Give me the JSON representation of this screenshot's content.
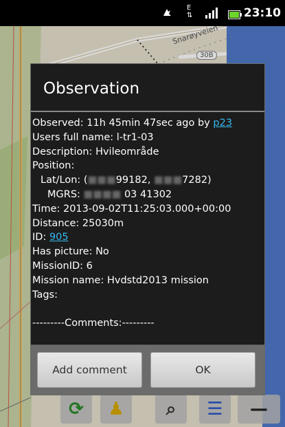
{
  "status_bar": {
    "time": "23:10",
    "icons": [
      "gps-icon",
      "data-arrows-icon",
      "signal-icon",
      "battery-icon"
    ],
    "network_letter": "E"
  },
  "map": {
    "road_labels": [
      "Snarøyveien",
      "30B"
    ]
  },
  "dialog": {
    "title": "Observation",
    "observed_prefix": "Observed:  11h 45min 47sec ago by ",
    "observed_by": "p23",
    "users_full_name": "Users full name: l-tr1-03",
    "description": "Description: Hvileområde",
    "position": "Position:",
    "latlon_label": "Lat/Lon: (",
    "latlon_value_a": "99182,",
    "latlon_value_b": "7282)",
    "mgrs_label": "MGRS:",
    "mgrs_value": "03   41302",
    "time": "Time: 2013-09-02T11:25:03.000+00:00",
    "distance": "Distance: 25030m",
    "id_label": "ID: ",
    "id_value": "905",
    "has_picture": "Has picture: No",
    "mission_id": "MissionID: 6",
    "mission_name": "Mission name: Hvdstd2013 mission",
    "tags": "Tags:",
    "comments_header": "---------Comments:---------",
    "buttons": {
      "add_comment": "Add comment",
      "ok": "OK"
    }
  },
  "colors": {
    "dialog_bg": "#1c1c1c",
    "link": "#35b9ee",
    "button_bar": "#6b6b6b"
  }
}
